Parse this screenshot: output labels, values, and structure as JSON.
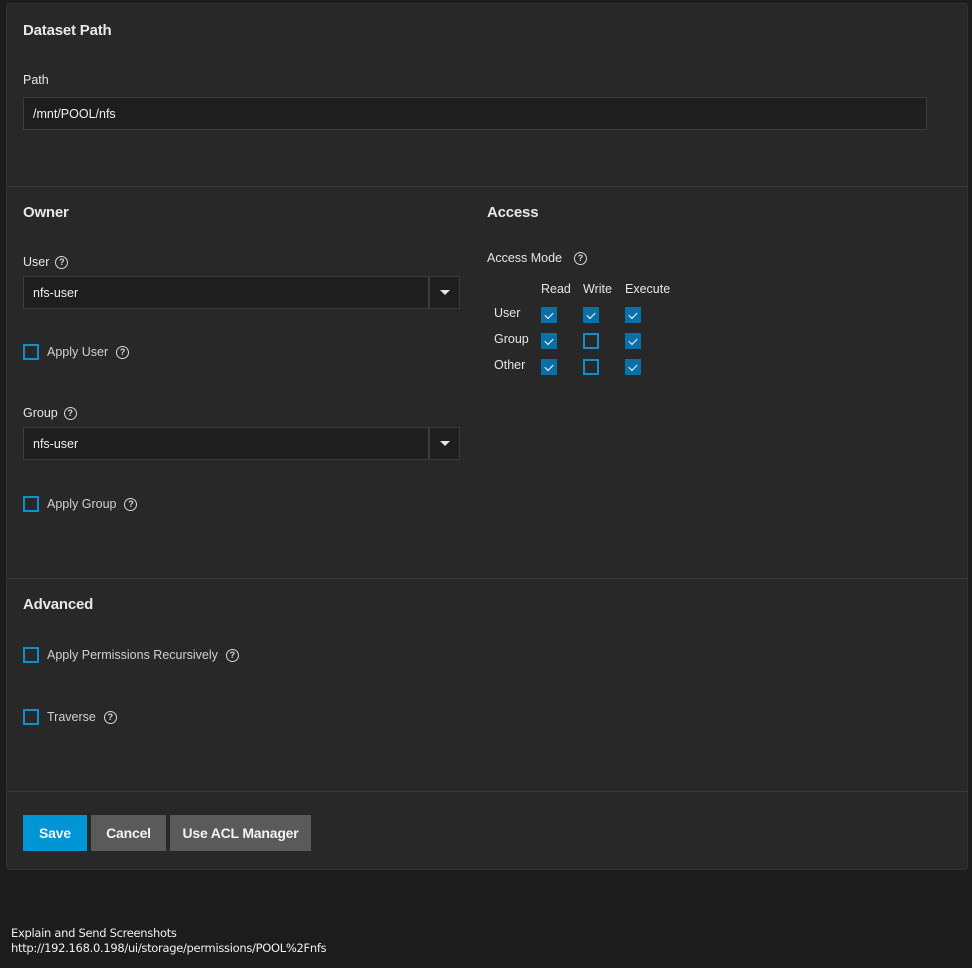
{
  "dataset_path": {
    "title": "Dataset Path",
    "path_label": "Path",
    "path_value": "/mnt/POOL/nfs"
  },
  "owner": {
    "title": "Owner",
    "user_label": "User",
    "user_value": "nfs-user",
    "apply_user_label": "Apply User",
    "apply_user_checked": false,
    "group_label": "Group",
    "group_value": "nfs-user",
    "apply_group_label": "Apply Group",
    "apply_group_checked": false
  },
  "access": {
    "title": "Access",
    "mode_label": "Access Mode",
    "columns": [
      "Read",
      "Write",
      "Execute"
    ],
    "rows": [
      {
        "label": "User",
        "read": true,
        "write": true,
        "execute": true
      },
      {
        "label": "Group",
        "read": true,
        "write": false,
        "execute": true
      },
      {
        "label": "Other",
        "read": true,
        "write": false,
        "execute": true
      }
    ]
  },
  "advanced": {
    "title": "Advanced",
    "recursive_label": "Apply Permissions Recursively",
    "recursive_checked": false,
    "traverse_label": "Traverse",
    "traverse_checked": false
  },
  "actions": {
    "save": "Save",
    "cancel": "Cancel",
    "acl": "Use ACL Manager"
  },
  "footer": {
    "line1": "Explain and Send Screenshots",
    "line2": "http://192.168.0.198/ui/storage/permissions/POOL%2Fnfs"
  },
  "colors": {
    "accent": "#0095d5",
    "checkbox": "#0b6fa8",
    "background": "#1c1c1c",
    "card": "#282828"
  }
}
